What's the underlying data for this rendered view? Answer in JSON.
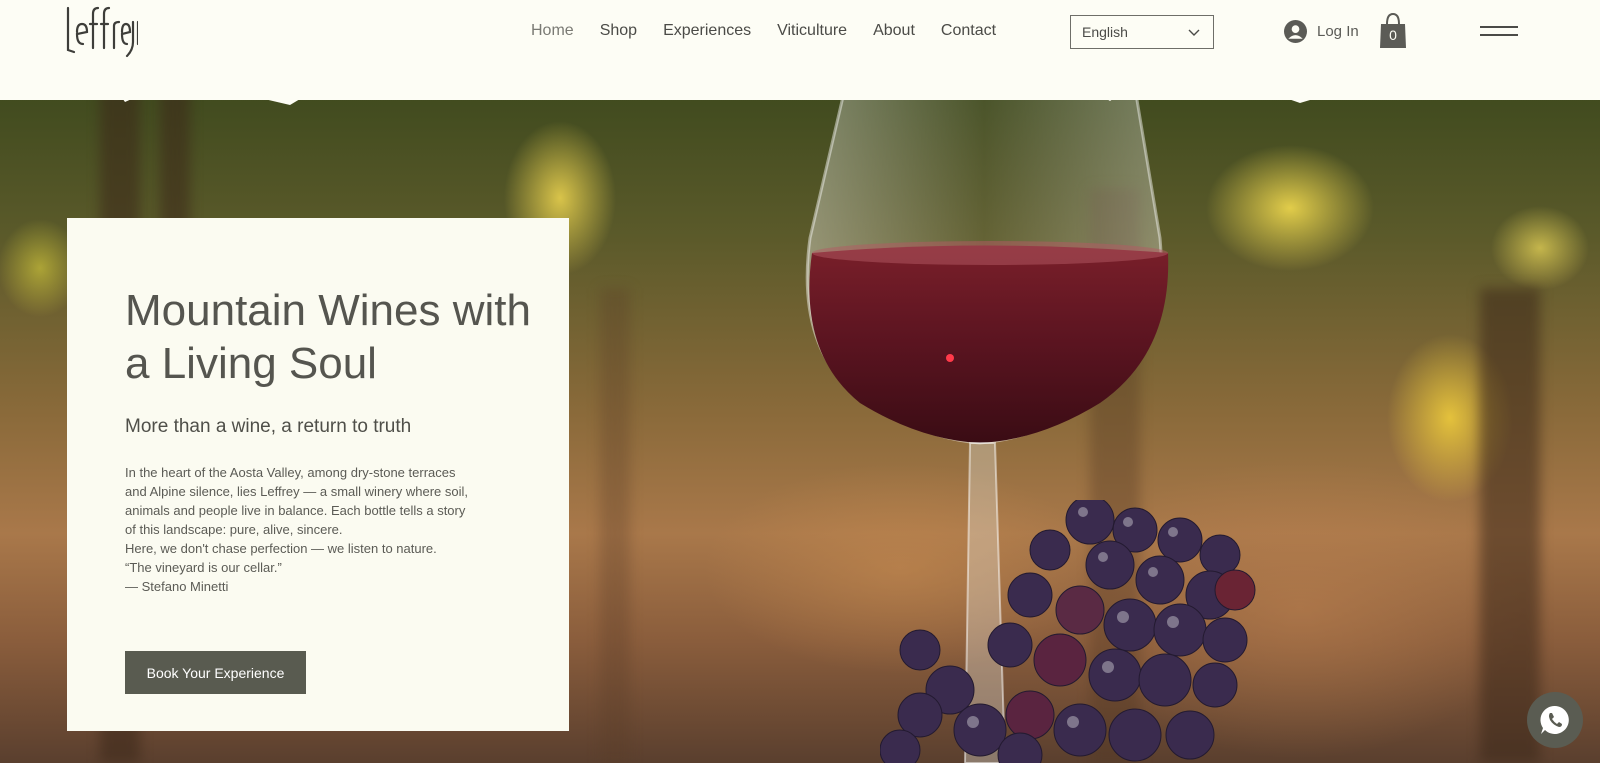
{
  "brand": {
    "logo_text": "leffrey"
  },
  "nav": {
    "items": [
      {
        "label": "Home"
      },
      {
        "label": "Shop"
      },
      {
        "label": "Experiences"
      },
      {
        "label": "Viticulture"
      },
      {
        "label": "About"
      },
      {
        "label": "Contact"
      }
    ]
  },
  "language": {
    "selected": "English"
  },
  "login": {
    "label": "Log In"
  },
  "cart": {
    "count": "0"
  },
  "hero": {
    "title": "Mountain Wines with a Living Soul",
    "subtitle": "More than a wine, a return to truth",
    "body": [
      "In the heart of the Aosta Valley, among dry-stone terraces and Alpine silence, lies Leffrey — a small winery where soil, animals and people live in balance. Each bottle tells a story of this landscape: pure, alive, sincere.",
      "Here, we don't chase perfection — we listen to nature.",
      "“The vineyard is our cellar.”",
      "— Stefano Minetti"
    ],
    "cta_label": "Book Your Experience"
  },
  "colors": {
    "background": "#fdfdf5",
    "card": "#fbfbf1",
    "text": "#4b4b47",
    "button": "#595b50"
  },
  "icons": {
    "language_chevron": "chevron-down-icon",
    "login": "user-avatar-icon",
    "cart": "shopping-bag-icon",
    "menu": "hamburger-menu-icon",
    "chat": "whatsapp-icon"
  }
}
